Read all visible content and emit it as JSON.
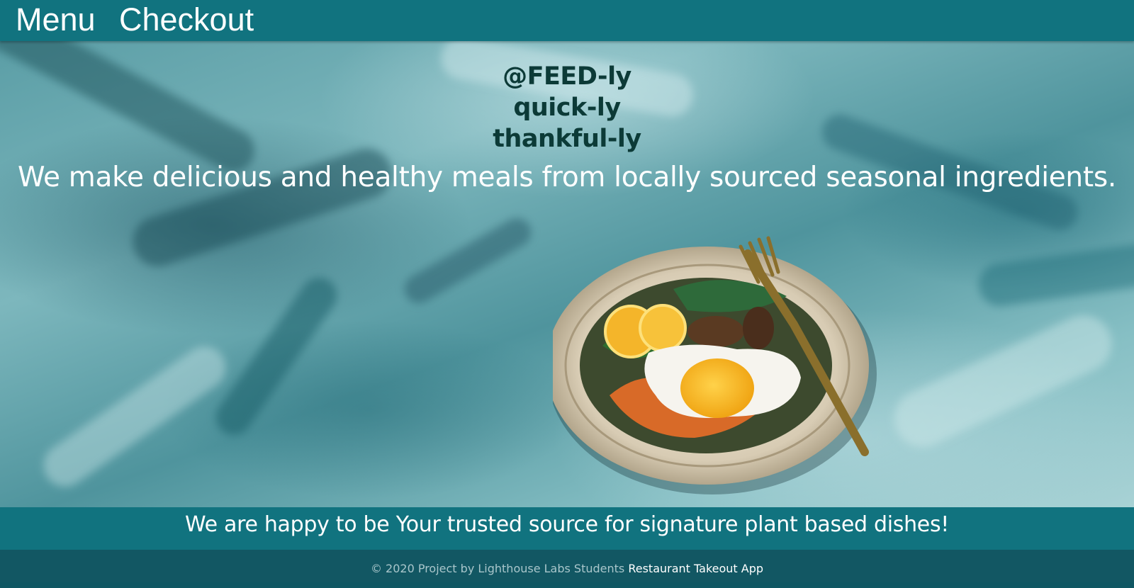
{
  "nav": {
    "menu_label": "Menu",
    "checkout_label": "Checkout"
  },
  "hero": {
    "tagline_lines": [
      "@FEED-ly",
      "quick-ly",
      "thankful-ly"
    ],
    "description": "We make delicious and healthy meals from locally sourced seasonal ingredients.",
    "image": "plate-of-food-with-egg-and-fork"
  },
  "banner": {
    "text": "We are happy to be Your trusted source for signature plant based dishes!"
  },
  "footer": {
    "copyright": "© 2020 Project by Lighthouse Labs Students",
    "app_link": "Restaurant Takeout App"
  },
  "colors": {
    "nav_bg": "#11737f",
    "footer_bg": "#125763",
    "tagline": "#0c3a37",
    "text_light": "#ffffff"
  }
}
